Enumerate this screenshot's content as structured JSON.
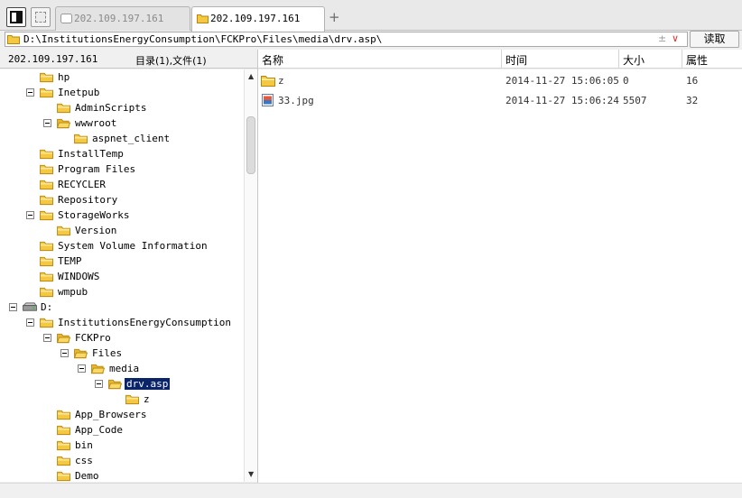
{
  "tabs": [
    {
      "label": "202.109.197.161",
      "state": "inactive"
    },
    {
      "label": "202.109.197.161",
      "state": "active"
    }
  ],
  "new_tab_label": "+",
  "address": {
    "path": "D:\\InstitutionsEnergyConsumption\\FCKPro\\Files\\media\\drv.asp\\",
    "plusminus": "±",
    "dropdown": "∨"
  },
  "read_button": "读取",
  "left_header": {
    "host": "202.109.197.161",
    "count": "目录(1),文件(1)"
  },
  "tree": [
    {
      "label": "hp",
      "icon": "folder-icon",
      "expander": false
    },
    {
      "label": "Inetpub",
      "icon": "folder-icon",
      "expander": true
    },
    {
      "label": "AdminScripts",
      "icon": "folder-icon",
      "expander": false
    },
    {
      "label": "wwwroot",
      "icon": "folder-open-icon",
      "expander": true
    },
    {
      "label": "aspnet_client",
      "icon": "folder-icon",
      "expander": false
    },
    {
      "label": "InstallTemp",
      "icon": "folder-icon",
      "expander": false
    },
    {
      "label": "Program Files",
      "icon": "folder-icon",
      "expander": false
    },
    {
      "label": "RECYCLER",
      "icon": "folder-icon",
      "expander": false
    },
    {
      "label": "Repository",
      "icon": "folder-icon",
      "expander": false
    },
    {
      "label": "StorageWorks",
      "icon": "folder-icon",
      "expander": true
    },
    {
      "label": "Version",
      "icon": "folder-icon",
      "expander": false
    },
    {
      "label": "System Volume Information",
      "icon": "folder-icon",
      "expander": false
    },
    {
      "label": "TEMP",
      "icon": "folder-icon",
      "expander": false
    },
    {
      "label": "WINDOWS",
      "icon": "folder-icon",
      "expander": false
    },
    {
      "label": "wmpub",
      "icon": "folder-icon",
      "expander": false
    },
    {
      "label": "D:",
      "icon": "drive-icon",
      "expander": true
    },
    {
      "label": "InstitutionsEnergyConsumption",
      "icon": "folder-icon",
      "expander": true
    },
    {
      "label": "FCKPro",
      "icon": "folder-open-icon",
      "expander": true
    },
    {
      "label": "Files",
      "icon": "folder-open-icon",
      "expander": true
    },
    {
      "label": "media",
      "icon": "folder-open-icon",
      "expander": true
    },
    {
      "label": "drv.asp",
      "icon": "folder-open-icon",
      "expander": true,
      "selected": true
    },
    {
      "label": "z",
      "icon": "folder-icon",
      "expander": false
    },
    {
      "label": "App_Browsers",
      "icon": "folder-icon",
      "expander": false
    },
    {
      "label": "App_Code",
      "icon": "folder-icon",
      "expander": false
    },
    {
      "label": "bin",
      "icon": "folder-icon",
      "expander": false
    },
    {
      "label": "css",
      "icon": "folder-icon",
      "expander": false
    },
    {
      "label": "Demo",
      "icon": "folder-icon",
      "expander": false
    }
  ],
  "columns": {
    "name": "名称",
    "time": "时间",
    "size": "大小",
    "attr": "属性"
  },
  "files": [
    {
      "name": "z",
      "icon": "folder-icon",
      "time": "2014-11-27 15:06:05",
      "size": "0",
      "attr": "16"
    },
    {
      "name": "33.jpg",
      "icon": "image-file-icon",
      "time": "2014-11-27 15:06:24",
      "size": "5507",
      "attr": "32"
    }
  ],
  "colors": {
    "selection": "#0a246a",
    "folder": "#f5c842",
    "folder_edge": "#b8860b"
  }
}
